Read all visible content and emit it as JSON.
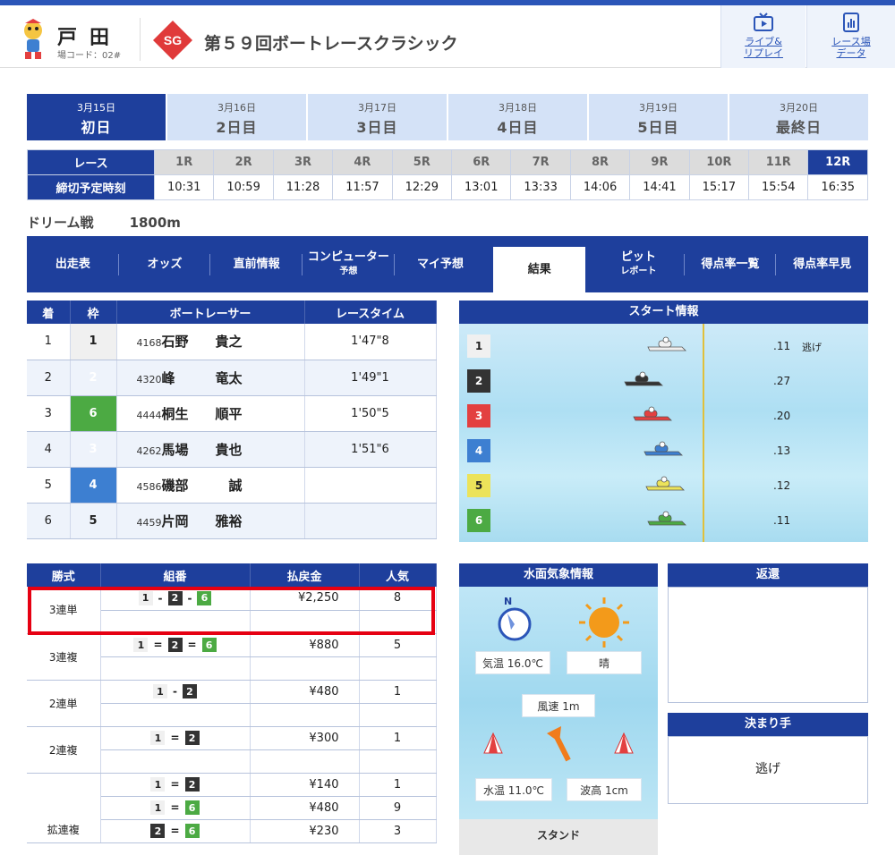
{
  "header": {
    "venue": "戸田",
    "venue_code": "場コード：02#",
    "grade": "SG",
    "race_title": "第５９回ボートレースクラシック",
    "buttons": [
      {
        "line1": "ライブ&",
        "line2": "リプレイ",
        "icon": "tv-play-icon"
      },
      {
        "line1": "レース場",
        "line2": "データ",
        "icon": "chart-doc-icon"
      }
    ]
  },
  "days": [
    {
      "date": "3月15日",
      "name": "初日",
      "active": true
    },
    {
      "date": "3月16日",
      "name": "2日目"
    },
    {
      "date": "3月17日",
      "name": "3日目"
    },
    {
      "date": "3月18日",
      "name": "4日目"
    },
    {
      "date": "3月19日",
      "name": "5日目"
    },
    {
      "date": "3月20日",
      "name": "最終日"
    }
  ],
  "races": {
    "label_race": "レース",
    "label_time": "締切予定時刻",
    "items": [
      {
        "r": "1R",
        "t": "10:31"
      },
      {
        "r": "2R",
        "t": "10:59"
      },
      {
        "r": "3R",
        "t": "11:28"
      },
      {
        "r": "4R",
        "t": "11:57"
      },
      {
        "r": "5R",
        "t": "12:29"
      },
      {
        "r": "6R",
        "t": "13:01"
      },
      {
        "r": "7R",
        "t": "13:33"
      },
      {
        "r": "8R",
        "t": "14:06"
      },
      {
        "r": "9R",
        "t": "14:41"
      },
      {
        "r": "10R",
        "t": "15:17"
      },
      {
        "r": "11R",
        "t": "15:54"
      },
      {
        "r": "12R",
        "t": "16:35",
        "active": true
      }
    ]
  },
  "race_info": {
    "name": "ドリーム戦",
    "distance": "1800m"
  },
  "tabs": [
    {
      "label": "出走表"
    },
    {
      "label": "オッズ"
    },
    {
      "label": "直前情報"
    },
    {
      "label": "コンピューター",
      "sub": "予想"
    },
    {
      "label": "マイ予想"
    },
    {
      "label": "結果",
      "active": true
    },
    {
      "label": "ピット",
      "sub": "レポート"
    },
    {
      "label": "得点率一覧"
    },
    {
      "label": "得点率早見"
    }
  ],
  "results": {
    "headers": [
      "着",
      "枠",
      "ボートレーサー",
      "レースタイム"
    ],
    "rows": [
      {
        "place": "1",
        "waku": "1",
        "reg": "4168",
        "name": "石野　　貴之",
        "time": "1'47\"8"
      },
      {
        "place": "2",
        "waku": "2",
        "reg": "4320",
        "name": "峰　　　竜太",
        "time": "1'49\"1"
      },
      {
        "place": "3",
        "waku": "6",
        "reg": "4444",
        "name": "桐生　　順平",
        "time": "1'50\"5"
      },
      {
        "place": "4",
        "waku": "3",
        "reg": "4262",
        "name": "馬場　　貴也",
        "time": "1'51\"6"
      },
      {
        "place": "5",
        "waku": "4",
        "reg": "4586",
        "name": "磯部　　　誠",
        "time": ""
      },
      {
        "place": "6",
        "waku": "5",
        "reg": "4459",
        "name": "片岡　　雅裕",
        "time": ""
      }
    ]
  },
  "start_info": {
    "title": "スタート情報",
    "rows": [
      {
        "course": "1",
        "st": ".11",
        "kimarite": "逃げ"
      },
      {
        "course": "2",
        "st": ".27"
      },
      {
        "course": "3",
        "st": ".20"
      },
      {
        "course": "4",
        "st": ".13"
      },
      {
        "course": "5",
        "st": ".12"
      },
      {
        "course": "6",
        "st": ".11"
      }
    ]
  },
  "payouts": {
    "headers": [
      "勝式",
      "組番",
      "払戻金",
      "人気"
    ],
    "groups": [
      {
        "kind": "3連単",
        "entries": [
          {
            "combo": [
              "1",
              "-",
              "2",
              "-",
              "6"
            ],
            "money": "¥2,250",
            "pop": "8"
          }
        ]
      },
      {
        "kind": "3連複",
        "entries": [
          {
            "combo": [
              "1",
              "=",
              "2",
              "=",
              "6"
            ],
            "money": "¥880",
            "pop": "5"
          }
        ]
      },
      {
        "kind": "2連単",
        "entries": [
          {
            "combo": [
              "1",
              "-",
              "2"
            ],
            "money": "¥480",
            "pop": "1"
          }
        ]
      },
      {
        "kind": "2連複",
        "entries": [
          {
            "combo": [
              "1",
              "=",
              "2"
            ],
            "money": "¥300",
            "pop": "1"
          }
        ]
      },
      {
        "kind": "拡連複",
        "entries": [
          {
            "combo": [
              "1",
              "=",
              "2"
            ],
            "money": "¥140",
            "pop": "1"
          },
          {
            "combo": [
              "1",
              "=",
              "6"
            ],
            "money": "¥480",
            "pop": "9"
          },
          {
            "combo": [
              "2",
              "=",
              "6"
            ],
            "money": "¥230",
            "pop": "3"
          }
        ]
      }
    ]
  },
  "weather": {
    "title": "水面気象情報",
    "compass_label": "N",
    "air_temp": "気温 16.0℃",
    "condition": "晴",
    "wind_speed": "風速 1m",
    "water_temp": "水温 11.0℃",
    "wave": "波高 1cm",
    "stand": "スタンド"
  },
  "refund": {
    "title": "返還",
    "value": ""
  },
  "kimarite": {
    "title": "決まり手",
    "value": "逃げ"
  },
  "colors": {
    "navy": "#1e3f9c",
    "waku1": "#f0f0f0",
    "waku2": "#333333",
    "waku3": "#e34040",
    "waku4": "#3d7fd1",
    "waku5": "#ece35a",
    "waku6": "#4caa43",
    "highlight": "#e60012"
  }
}
